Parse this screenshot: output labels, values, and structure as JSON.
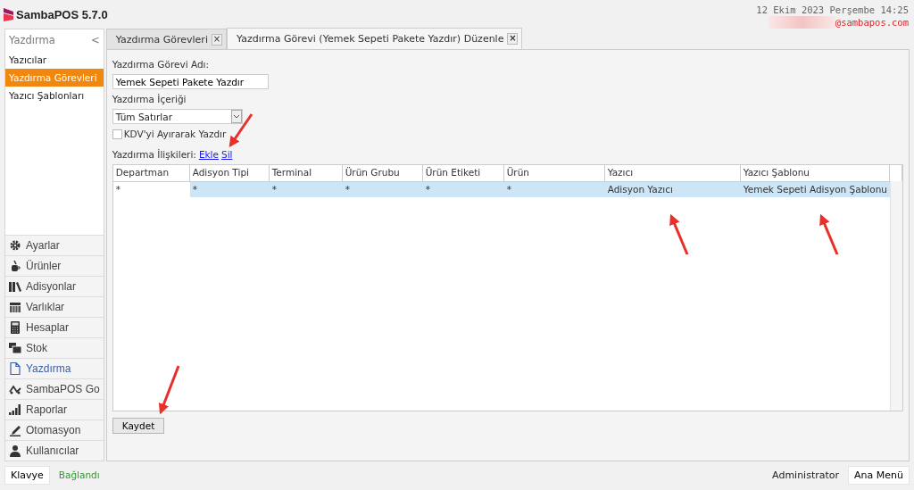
{
  "app": {
    "title": "SambaPOS 5.7.0",
    "datetime": "12 Ekim 2023 Perşembe 14:25",
    "user_email": "@sambapos.com"
  },
  "sidebar": {
    "header": "Yazdırma",
    "collapse": "<",
    "items": [
      {
        "label": "Yazıcılar",
        "selected": false
      },
      {
        "label": "Yazdırma Görevleri",
        "selected": true
      },
      {
        "label": "Yazıcı Şablonları",
        "selected": false
      }
    ],
    "nav": [
      {
        "label": "Ayarlar",
        "selected": false
      },
      {
        "label": "Ürünler",
        "selected": false
      },
      {
        "label": "Adisyonlar",
        "selected": false
      },
      {
        "label": "Varlıklar",
        "selected": false
      },
      {
        "label": "Hesaplar",
        "selected": false
      },
      {
        "label": "Stok",
        "selected": false
      },
      {
        "label": "Yazdırma",
        "selected": true
      },
      {
        "label": "SambaPOS Go",
        "selected": false
      },
      {
        "label": "Raporlar",
        "selected": false
      },
      {
        "label": "Otomasyon",
        "selected": false
      },
      {
        "label": "Kullanıcılar",
        "selected": false
      }
    ]
  },
  "tabs": [
    {
      "label": "Yazdırma Görevleri",
      "close": "×",
      "selected": false
    },
    {
      "label": "Yazdırma Görevi (Yemek Sepeti Pakete Yazdır) Düzenle",
      "close": "×",
      "selected": true
    }
  ],
  "form": {
    "name_label": "Yazdırma Görevi Adı:",
    "name_value": "Yemek Sepeti Pakete Yazdır",
    "content_label": "Yazdırma İçeriği",
    "content_value": "Tüm Satırlar",
    "vat_checkbox": {
      "label": "KDV'yi Ayırarak Yazdır",
      "checked": false
    },
    "relations_label": "Yazdırma İlişkileri:",
    "add_link": "Ekle",
    "remove_link": "Sil"
  },
  "table": {
    "columns": [
      "Departman",
      "Adisyon Tipi",
      "Terminal",
      "Ürün Grubu",
      "Ürün Etiketi",
      "Ürün",
      "Yazıcı",
      "Yazıcı Şablonu"
    ],
    "rows": [
      {
        "selected": true,
        "cells": [
          {
            "text": "*",
            "focused": true
          },
          {
            "text": "*",
            "focused": false
          },
          {
            "text": "*",
            "focused": false
          },
          {
            "text": "*",
            "focused": false
          },
          {
            "text": "*",
            "focused": false
          },
          {
            "text": "*",
            "focused": false
          },
          {
            "text": "Adisyon Yazıcı",
            "focused": false
          },
          {
            "text": "Yemek Sepeti Adisyon Şablonu",
            "focused": false
          }
        ]
      }
    ]
  },
  "save_button": "Kaydet",
  "status_bar": {
    "keyboard_button": "Klavye",
    "connection": "Bağlandı",
    "user": "Administrator",
    "main_menu_button": "Ana Menü"
  }
}
